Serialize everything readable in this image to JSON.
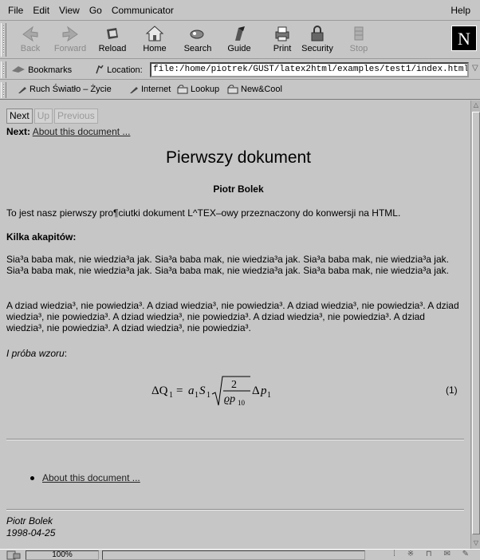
{
  "menu": [
    "File",
    "Edit",
    "View",
    "Go",
    "Communicator"
  ],
  "menu_help": "Help",
  "toolbar": [
    {
      "label": "Back",
      "icon": "back-arrow-icon",
      "disabled": true
    },
    {
      "label": "Forward",
      "icon": "forward-arrow-icon",
      "disabled": true
    },
    {
      "label": "Reload",
      "icon": "reload-icon",
      "disabled": false
    },
    {
      "label": "Home",
      "icon": "home-icon",
      "disabled": false
    },
    {
      "label": "Search",
      "icon": "search-icon",
      "disabled": false
    },
    {
      "label": "Guide",
      "icon": "guide-icon",
      "disabled": false
    },
    {
      "label": "Print",
      "icon": "print-icon",
      "disabled": false
    },
    {
      "label": "Security",
      "icon": "security-lock-icon",
      "disabled": false
    },
    {
      "label": "Stop",
      "icon": "stop-icon",
      "disabled": true
    }
  ],
  "logo_letter": "N",
  "location": {
    "bookmarks_label": "Bookmarks",
    "label": "Location:",
    "url": "file:/home/piotrek/GUST/latex2html/examples/test1/index.html"
  },
  "personal_toolbar": [
    "Ruch Światło – Życie",
    "Internet",
    "Lookup",
    "New&Cool"
  ],
  "page": {
    "nav_next": "Next",
    "nav_up": "Up",
    "nav_previous": "Previous",
    "next_label": "Next:",
    "next_link": "About this document ...",
    "title": "Pierwszy dokument",
    "author": "Piotr Bolek",
    "intro": "To jest nasz pierwszy pro¶ciutki dokument L^TEX–owy przeznaczony do konwersji na HTML.",
    "section": "Kilka akapitów:",
    "para1": "Sia³a baba mak, nie wiedzia³a jak. Sia³a baba mak, nie wiedzia³a jak. Sia³a baba mak, nie wiedzia³a jak. Sia³a baba mak, nie wiedzia³a jak. Sia³a baba mak, nie wiedzia³a jak. Sia³a baba mak, nie wiedzia³a jak.",
    "para2": "A dziad wiedzia³, nie powiedzia³. A dziad wiedzia³, nie powiedzia³. A dziad wiedzia³, nie powiedzia³. A dziad wiedzia³, nie powiedzia³. A dziad wiedzia³, nie powiedzia³. A dziad wiedzia³, nie powiedzia³. A dziad wiedzia³, nie powiedzia³. A dziad wiedzia³, nie powiedzia³.",
    "emph": "I próba wzoru",
    "emph_suffix": ":",
    "eq_number": "(1)",
    "bullet_link": "About this document ...",
    "sig_name": "Piotr Bolek",
    "sig_date": "1998-04-25"
  },
  "status": {
    "zoom": "100%"
  }
}
